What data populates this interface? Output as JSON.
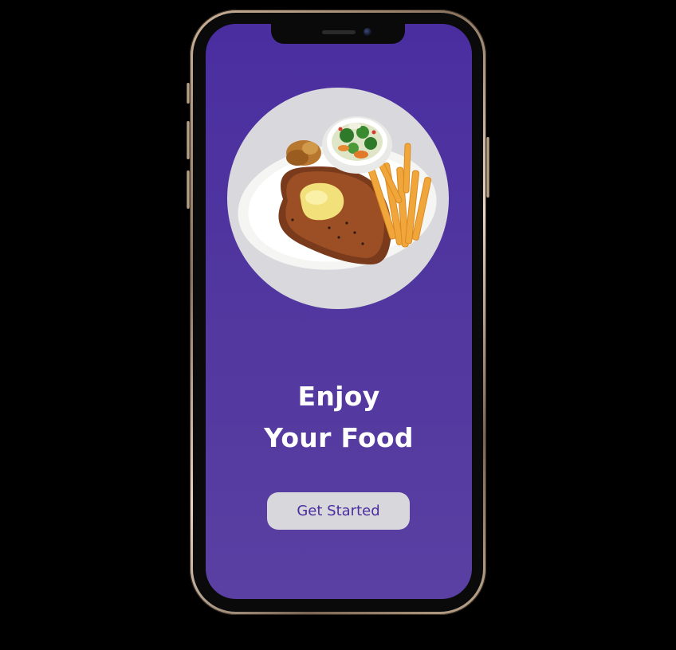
{
  "screen": {
    "headline_line1": "Enjoy",
    "headline_line2": "Your Food",
    "cta_label": "Get Started"
  },
  "colors": {
    "screen_bg": "#4a2ea0",
    "headline": "#ffffff",
    "cta_bg": "#d8d7dc",
    "cta_text": "#4a2ea0",
    "image_circle_bg": "#d9d8dc"
  },
  "icons": {
    "hero_image": "steak-fries-salad-plate-illustration"
  }
}
